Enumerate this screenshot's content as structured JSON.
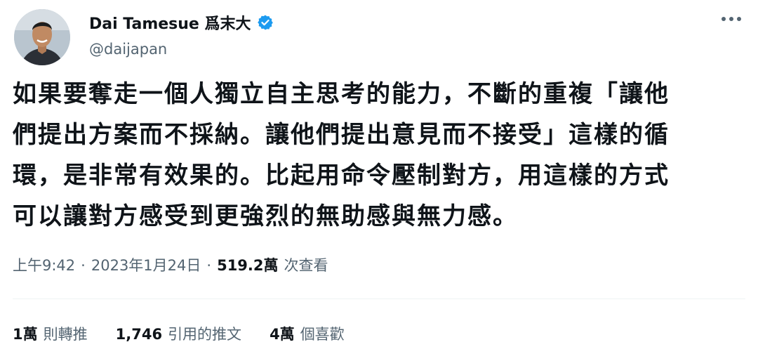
{
  "author": {
    "display_name": "Dai Tamesue 爲末大",
    "handle": "@daijapan",
    "verified": true
  },
  "tweet": {
    "lines": [
      "如果要奪走一個人獨立自主思考的能力，不斷的重複「讓他",
      "們提出方案而不採納。讓他們提出意見而不接受」這樣的循",
      "環，是非常有效果的。比起用命令壓制對方，用這樣的方式",
      "可以讓對方感受到更強烈的無助感與無力感。"
    ]
  },
  "meta": {
    "time": "上午9:42",
    "separator": "·",
    "date": "2023年1月24日",
    "views_count": "519.2萬",
    "views_label": "次查看"
  },
  "stats": {
    "retweets_count": "1萬",
    "retweets_label": "則轉推",
    "quotes_count": "1,746",
    "quotes_label": "引用的推文",
    "likes_count": "4萬",
    "likes_label": "個喜歡"
  },
  "colors": {
    "primary_text": "#0f1419",
    "secondary_text": "#536471",
    "verified_blue": "#1d9bf0",
    "divider": "#eff3f4"
  },
  "icons": [
    "avatar-photo",
    "verified-badge-icon",
    "more-options-icon"
  ]
}
